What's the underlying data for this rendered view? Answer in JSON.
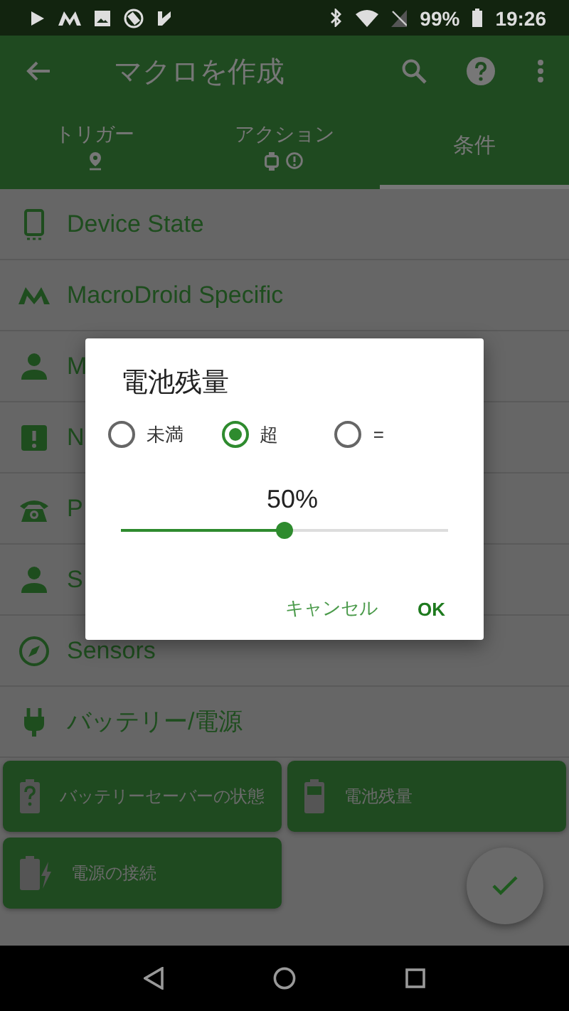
{
  "status_bar": {
    "battery": "99%",
    "time": "19:26"
  },
  "toolbar": {
    "title": "マクロを作成"
  },
  "tabs": [
    {
      "label": "トリガー",
      "selected": false,
      "icons": [
        {
          "kind": "pin"
        }
      ]
    },
    {
      "label": "アクション",
      "selected": false,
      "icons": [
        {
          "kind": "watch"
        },
        {
          "kind": "alert"
        }
      ]
    },
    {
      "label": "条件",
      "selected": true
    }
  ],
  "categories": [
    {
      "label": "Device State",
      "kind": "phone"
    },
    {
      "label": "MacroDroid Specific",
      "kind": "logo"
    },
    {
      "label": "M",
      "kind": "person"
    },
    {
      "label": "N",
      "kind": "alert"
    },
    {
      "label": "P",
      "kind": "telephone"
    },
    {
      "label": "S",
      "kind": "person"
    },
    {
      "label": "Sensors",
      "kind": "compass"
    },
    {
      "label": "バッテリー/電源",
      "kind": "plug"
    }
  ],
  "cards": [
    {
      "label": "バッテリーセーバーの状態",
      "kind": "battery-question"
    },
    {
      "label": "電池残量",
      "kind": "battery"
    },
    {
      "label": "電源の接続",
      "kind": "battery-charge"
    }
  ],
  "dialog": {
    "title": "電池残量",
    "options": [
      {
        "label": "未満",
        "selected": false
      },
      {
        "label": "超",
        "selected": true
      },
      {
        "label": "=",
        "selected": false
      }
    ],
    "reading": "50%",
    "slider": {
      "level": 0.5
    },
    "buttons": [
      {
        "label": "キャンセル",
        "kind": "secondary"
      },
      {
        "label": "OK",
        "kind": "primary"
      }
    ]
  }
}
